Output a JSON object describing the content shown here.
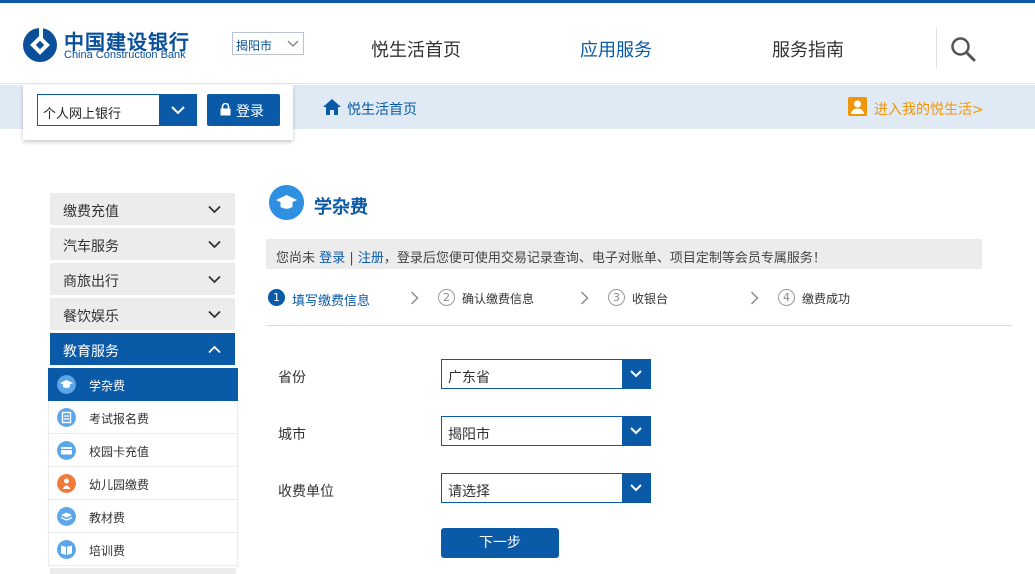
{
  "header": {
    "logo_cn": "中国建设银行",
    "logo_en": "China Construction Bank",
    "city": "揭阳市",
    "nav": [
      {
        "label": "悦生活首页",
        "active": false
      },
      {
        "label": "应用服务",
        "active": true
      },
      {
        "label": "服务指南",
        "active": false
      }
    ]
  },
  "subbar": {
    "bank_select": "个人网上银行",
    "login_label": "登录",
    "home_link": "悦生活首页",
    "enter_link": "进入我的悦生活>"
  },
  "sidebar": {
    "categories": [
      {
        "label": "缴费充值",
        "open": false
      },
      {
        "label": "汽车服务",
        "open": false
      },
      {
        "label": "商旅出行",
        "open": false
      },
      {
        "label": "餐饮娱乐",
        "open": false
      },
      {
        "label": "教育服务",
        "open": true
      }
    ],
    "sub_items": [
      {
        "label": "学杂费",
        "active": true,
        "icon": "graduation-cap-icon",
        "color": "#5aa6e8"
      },
      {
        "label": "考试报名费",
        "active": false,
        "icon": "exam-icon",
        "color": "#5aa6e8"
      },
      {
        "label": "校园卡充值",
        "active": false,
        "icon": "card-icon",
        "color": "#5aa6e8"
      },
      {
        "label": "幼儿园缴费",
        "active": false,
        "icon": "kindergarten-icon",
        "color": "#f07a3a"
      },
      {
        "label": "教材费",
        "active": false,
        "icon": "book-stack-icon",
        "color": "#5aa6e8"
      },
      {
        "label": "培训费",
        "active": false,
        "icon": "open-book-icon",
        "color": "#5aa6e8"
      }
    ]
  },
  "main": {
    "title": "学杂费",
    "notice": {
      "prefix": "您尚未",
      "login": "登录",
      "sep": "|",
      "register": "注册",
      "suffix": "，登录后您便可使用交易记录查询、电子对账单、项目定制等会员专属服务！"
    },
    "steps": [
      {
        "num": "1",
        "label": "填写缴费信息",
        "active": true
      },
      {
        "num": "2",
        "label": "确认缴费信息",
        "active": false
      },
      {
        "num": "3",
        "label": "收银台",
        "active": false
      },
      {
        "num": "4",
        "label": "缴费成功",
        "active": false
      }
    ],
    "form": [
      {
        "label": "省份",
        "value": "广东省"
      },
      {
        "label": "城市",
        "value": "揭阳市"
      },
      {
        "label": "收费单位",
        "value": "请选择"
      }
    ],
    "next_label": "下一步"
  },
  "colors": {
    "brand": "#0a5aa8",
    "accent_orange": "#f0960a",
    "subbar_bg": "#e0eaf5"
  }
}
